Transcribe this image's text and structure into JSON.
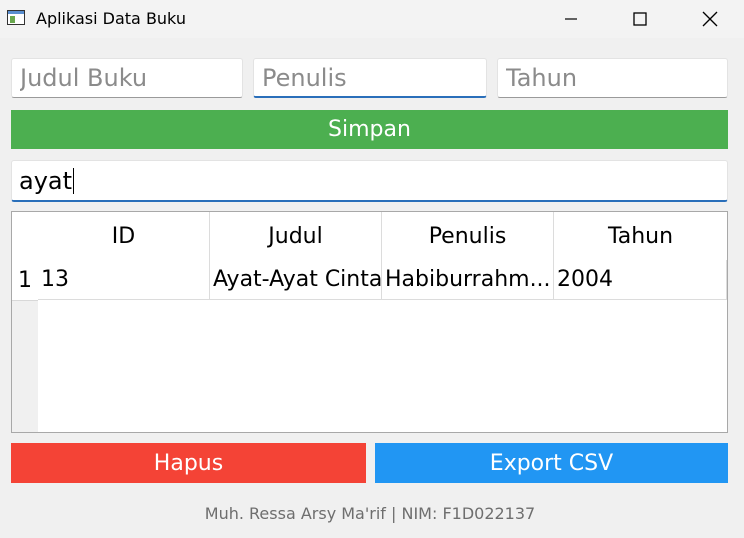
{
  "window": {
    "title": "Aplikasi Data Buku"
  },
  "form": {
    "judul_placeholder": "Judul Buku",
    "penulis_placeholder": "Penulis",
    "tahun_placeholder": "Tahun",
    "save_label": "Simpan"
  },
  "search": {
    "value": "ayat"
  },
  "table": {
    "headers": [
      "ID",
      "Judul",
      "Penulis",
      "Tahun"
    ],
    "rows": [
      {
        "num": "1",
        "cells": [
          "13",
          "Ayat-Ayat Cinta",
          "Habiburrahm...",
          "2004"
        ]
      }
    ]
  },
  "actions": {
    "delete_label": "Hapus",
    "export_label": "Export CSV"
  },
  "footer": {
    "text": "Muh. Ressa Arsy Ma'rif | NIM: F1D022137"
  },
  "colors": {
    "save": "#4caf50",
    "delete": "#f44336",
    "export": "#2196f3"
  }
}
